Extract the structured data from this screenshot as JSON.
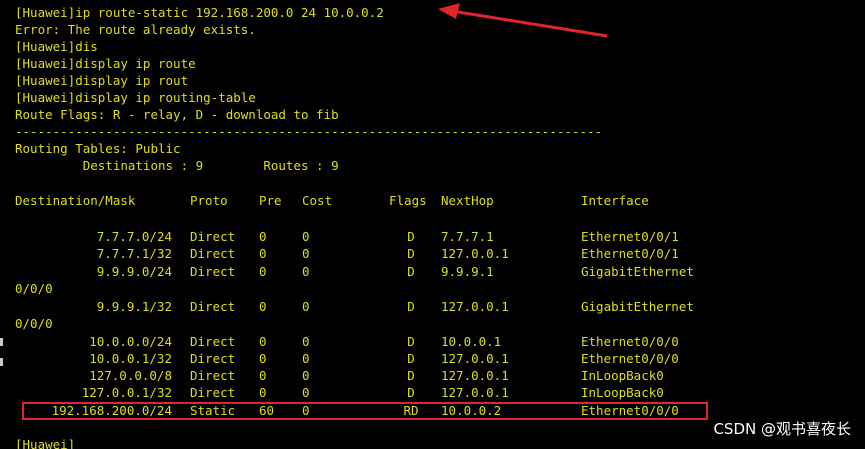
{
  "terminal": {
    "lines": [
      "[Huawei]ip route-static 192.168.200.0 24 10.0.0.2",
      "Error: The route already exists.",
      "[Huawei]dis",
      "[Huawei]display ip route",
      "[Huawei]display ip rout",
      "[Huawei]display ip routing-table",
      "Route Flags: R - relay, D - download to fib",
      "------------------------------------------------------------------------------",
      "Routing Tables: Public",
      "         Destinations : 9        Routes : 9"
    ],
    "headers": {
      "destination": "Destination/Mask",
      "proto": "Proto",
      "pre": "Pre",
      "cost": "Cost",
      "flags": "Flags",
      "nexthop": "NextHop",
      "interface": "Interface"
    },
    "routes": [
      {
        "destination": "7.7.7.0/24",
        "proto": "Direct",
        "pre": "0",
        "cost": "0",
        "flags": "D",
        "nexthop": "7.7.7.1",
        "interface": "Ethernet0/0/1",
        "wrap": ""
      },
      {
        "destination": "7.7.7.1/32",
        "proto": "Direct",
        "pre": "0",
        "cost": "0",
        "flags": "D",
        "nexthop": "127.0.0.1",
        "interface": "Ethernet0/0/1",
        "wrap": ""
      },
      {
        "destination": "9.9.9.0/24",
        "proto": "Direct",
        "pre": "0",
        "cost": "0",
        "flags": "D",
        "nexthop": "9.9.9.1",
        "interface": "GigabitEthernet",
        "wrap": "0/0/0"
      },
      {
        "destination": "9.9.9.1/32",
        "proto": "Direct",
        "pre": "0",
        "cost": "0",
        "flags": "D",
        "nexthop": "127.0.0.1",
        "interface": "GigabitEthernet",
        "wrap": "0/0/0"
      },
      {
        "destination": "10.0.0.0/24",
        "proto": "Direct",
        "pre": "0",
        "cost": "0",
        "flags": "D",
        "nexthop": "10.0.0.1",
        "interface": "Ethernet0/0/0",
        "wrap": ""
      },
      {
        "destination": "10.0.0.1/32",
        "proto": "Direct",
        "pre": "0",
        "cost": "0",
        "flags": "D",
        "nexthop": "127.0.0.1",
        "interface": "Ethernet0/0/0",
        "wrap": ""
      },
      {
        "destination": "127.0.0.0/8",
        "proto": "Direct",
        "pre": "0",
        "cost": "0",
        "flags": "D",
        "nexthop": "127.0.0.1",
        "interface": "InLoopBack0",
        "wrap": ""
      },
      {
        "destination": "127.0.0.1/32",
        "proto": "Direct",
        "pre": "0",
        "cost": "0",
        "flags": "D",
        "nexthop": "127.0.0.1",
        "interface": "InLoopBack0",
        "wrap": ""
      },
      {
        "destination": "192.168.200.0/24",
        "proto": "Static",
        "pre": "60",
        "cost": "0",
        "flags": "RD",
        "nexthop": "10.0.0.2",
        "interface": "Ethernet0/0/0",
        "wrap": ""
      }
    ],
    "prompt": "[Huawei]"
  },
  "watermark": "CSDN @观书喜夜长",
  "colors": {
    "background": "#000000",
    "text": "#dede1c",
    "annotation": "#e2242b",
    "watermark": "#ffffff"
  },
  "icons": {
    "annotation_arrow": "red-arrow-icon"
  }
}
